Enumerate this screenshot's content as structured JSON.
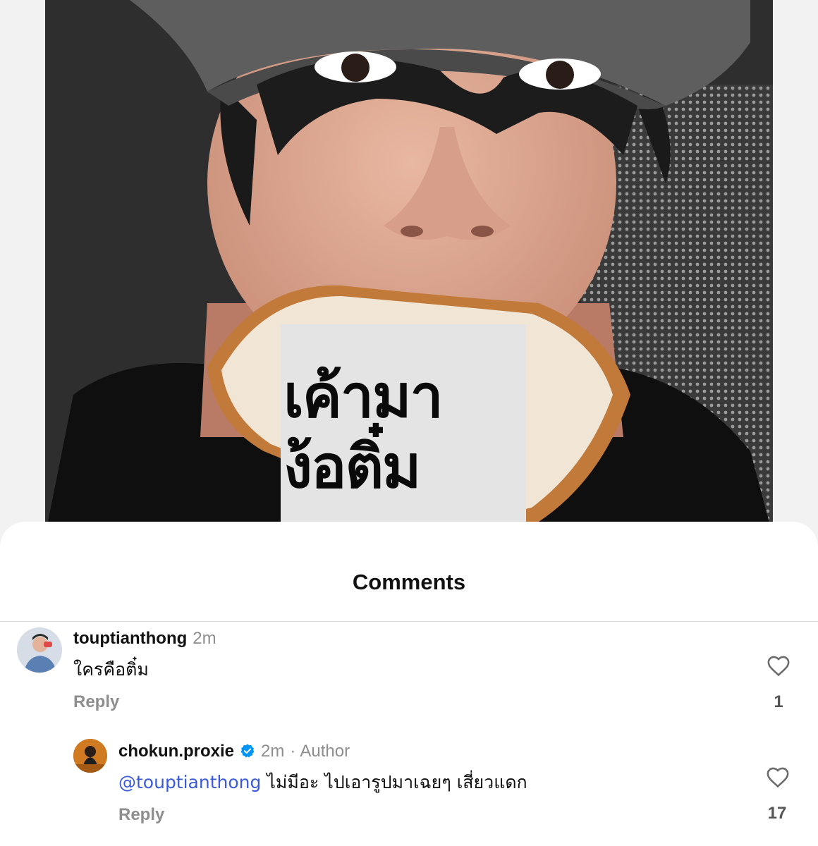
{
  "photo": {
    "sticker_line_1": "เค้ามา",
    "sticker_line_2": "ง้อติ๋ม"
  },
  "comments_sheet": {
    "title": "Comments",
    "comments": [
      {
        "username": "touptianthong",
        "time": "2m",
        "text": "ใครคือติ๋ม",
        "reply_label": "Reply",
        "likes": "1"
      },
      {
        "username": "chokun.proxie",
        "verified": true,
        "time": "2m",
        "separator": "·",
        "author_label": "Author",
        "mention": "@touptianthong",
        "text": " ไม่มีอะ ไปเอารูปมาเฉยๆ เสี่ยวแดก",
        "reply_label": "Reply",
        "likes": "17"
      }
    ]
  },
  "colors": {
    "mention": "#3b5bdb",
    "verified_badge": "#0095f6",
    "muted_text": "#8e8e8e"
  },
  "icons": [
    "heart-outline-icon",
    "verified-badge-icon"
  ]
}
